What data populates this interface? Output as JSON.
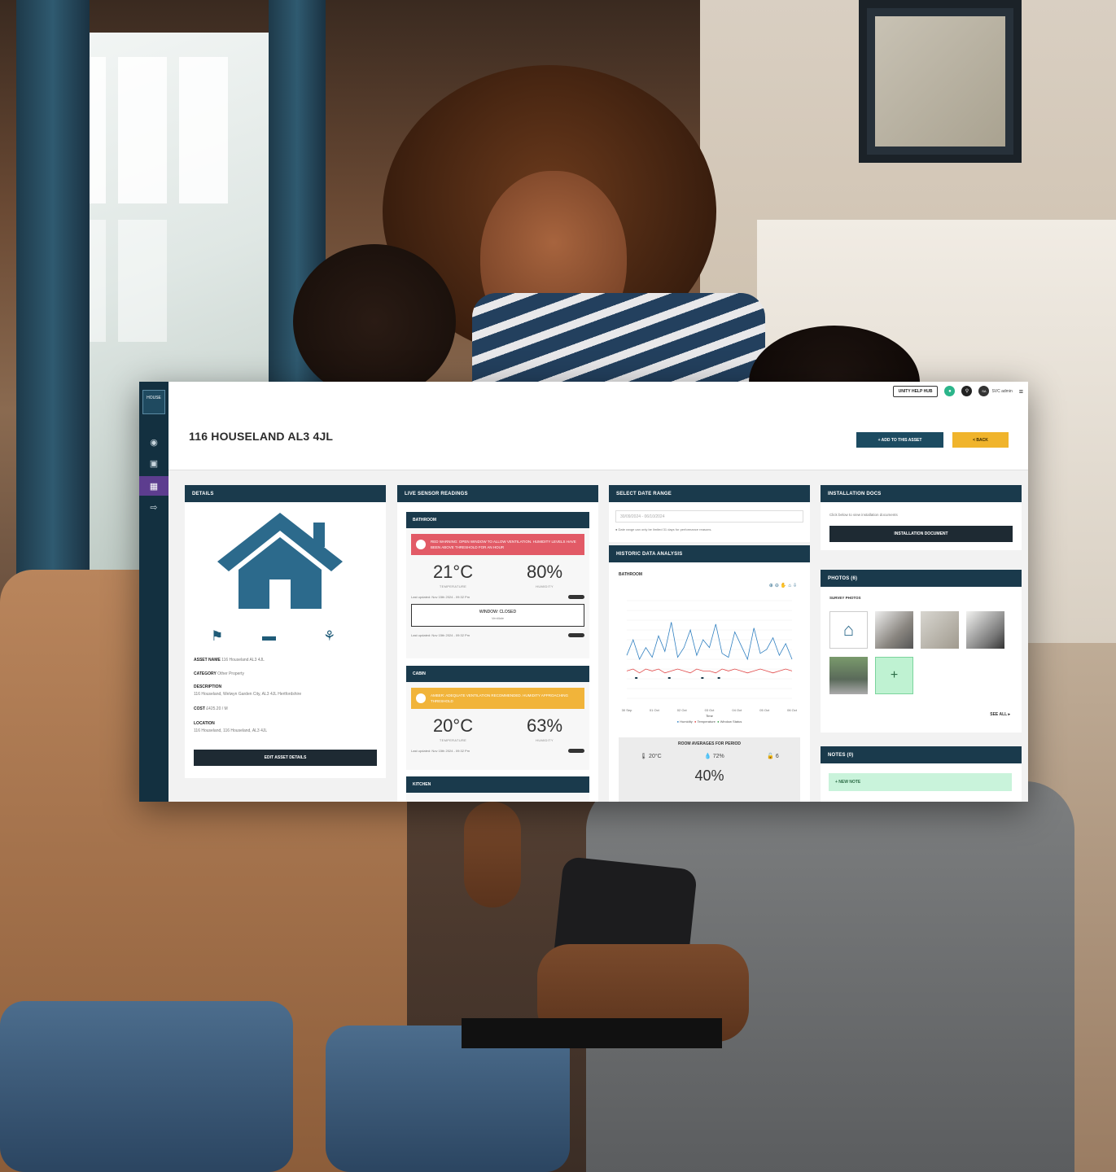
{
  "header": {
    "help_label": "UNITY HELP HUB",
    "user_initials": "SA",
    "user_label": "SVC admin"
  },
  "sidebar": {
    "logo_text": "HOUSE"
  },
  "page": {
    "title": "116 HOUSELAND AL3 4JL",
    "asset_button": "+ ADD TO THIS ASSET",
    "back_button": "< BACK"
  },
  "details": {
    "heading": "DETAILS",
    "asset_name_label": "ASSET NAME",
    "asset_name_value": "116 Houseland AL3 4JL",
    "category_label": "CATEGORY",
    "category_value": "Other Property",
    "description_label": "DESCRIPTION",
    "description_value": "116 Houseland, Welwyn Garden City, AL3 4JL Hertfordshire",
    "cost_label": "COST",
    "cost_value": "£425.20 / M",
    "location_label": "LOCATION",
    "location_value": "116 Houseland, 116 Houseland, AL3 4JL",
    "button": "EDIT ASSET DETAILS"
  },
  "live": {
    "heading": "LIVE SENSOR READINGS",
    "rooms": [
      {
        "name": "BATHROOM",
        "alert": "RED WARNING: OPEN WINDOW TO ALLOW VENTILATION. HUMIDITY LEVELS HAVE BEEN ABOVE THRESHOLD FOR AN HOUR",
        "alert_color": "#e25a66",
        "temperature": "21°C",
        "temperature_label": "TEMPERATURE",
        "humidity": "80%",
        "humidity_label": "HUMIDITY",
        "updated": "Last updated: Nov 15th 2024 - 09:32 Pm",
        "window_status": "WINDOW: CLOSED",
        "window_sub": "Ventilate",
        "updated2": "Last updated: Nov 15th 2024 - 09:32 Pm"
      },
      {
        "name": "CABIN",
        "alert": "AMBER: ADEQUATE VENTILATION RECOMMENDED. HUMIDITY APPROACHING THRESHOLD",
        "alert_color": "#f1b43a",
        "temperature": "20°C",
        "temperature_label": "TEMPERATURE",
        "humidity": "63%",
        "humidity_label": "HUMIDITY",
        "updated": "Last updated: Nov 15th 2024 - 09:32 Pm"
      },
      {
        "name": "KITCHEN"
      }
    ]
  },
  "daterange": {
    "heading": "SELECT DATE RANGE",
    "value": "30/09/2024 - 06/10/2024",
    "note": "Date range can only be limited 31 days for performance reasons.",
    "analysis_heading": "HISTORIC DATA ANALYSIS",
    "room": "BATHROOM",
    "legend": [
      "Humidity",
      "Temperature",
      "Window Status"
    ],
    "x_label": "Time",
    "averages_title": "ROOM AVERAGES FOR PERIOD",
    "avg_temp": "20°C",
    "avg_humidity": "72%",
    "avg_windows": "6",
    "avg_percent": "40%"
  },
  "chart_data": {
    "type": "line",
    "title": "",
    "xlabel": "Time",
    "ylabel": "",
    "x": [
      "30 Sep",
      "01 Oct",
      "02 Oct",
      "03 Oct",
      "04 Oct",
      "05 Oct",
      "06 Oct"
    ],
    "series": [
      {
        "name": "Humidity",
        "color": "#2f7fc0",
        "values": [
          62,
          70,
          60,
          66,
          61,
          72,
          64,
          79,
          61,
          66,
          75,
          62,
          70,
          66,
          78,
          63,
          61,
          74,
          67,
          60,
          76,
          63,
          65,
          71,
          62,
          68,
          60
        ]
      },
      {
        "name": "Temperature",
        "color": "#e04848",
        "values": [
          54,
          55,
          53,
          55,
          54,
          55,
          53,
          54,
          55,
          54,
          53,
          55,
          54,
          54,
          53,
          55,
          54,
          55,
          54,
          53,
          54,
          55,
          54,
          53,
          54,
          55,
          54
        ]
      },
      {
        "name": "Window Status",
        "color": "#3aa34b",
        "values": []
      }
    ],
    "grid": true,
    "legend": "bottom"
  },
  "docs": {
    "heading": "INSTALLATION DOCS",
    "text": "Click below to view installation documents",
    "button": "INSTALLATION DOCUMENT"
  },
  "photos": {
    "heading": "PHOTOS (6)",
    "sub": "SURVEY PHOTOS",
    "see_all": "SEE ALL"
  },
  "notes": {
    "heading": "NOTES (0)",
    "new_note": "+ NEW NOTE"
  },
  "colors": {
    "navy": "#1a3a4c",
    "accent": "#f0b42c",
    "sidebar_active": "#5d3d8f"
  }
}
